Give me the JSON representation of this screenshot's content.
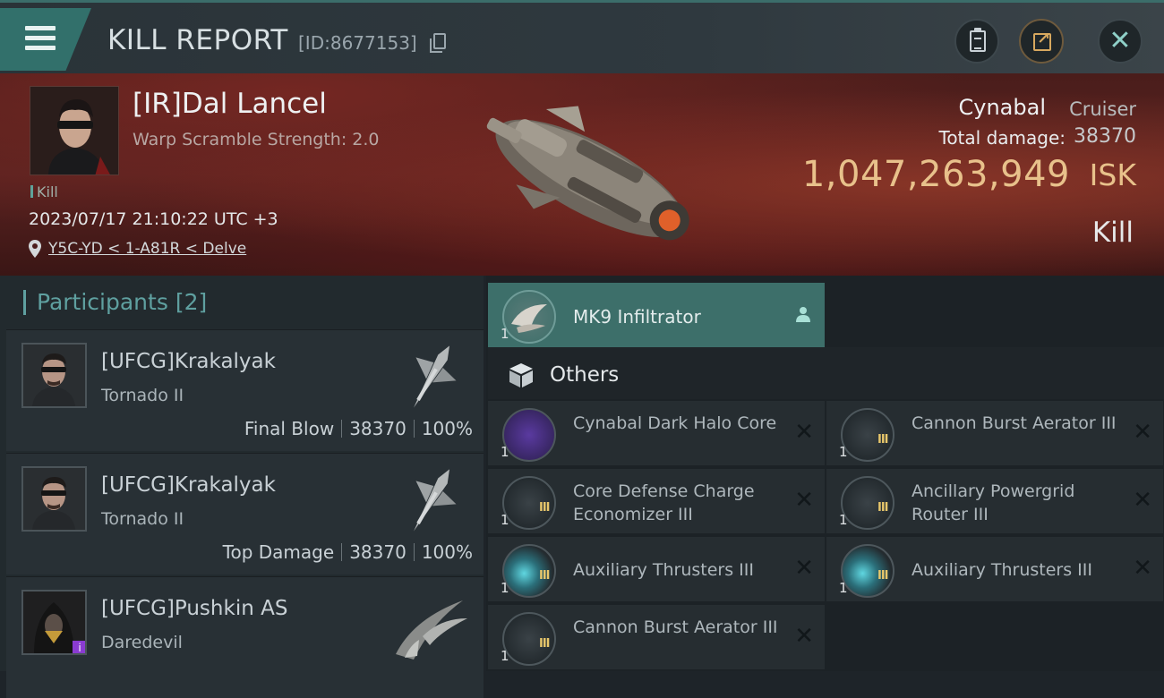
{
  "header": {
    "title": "KILL REPORT",
    "report_id": "[ID:8677153]",
    "menu_icon": "hamburger-menu-icon",
    "buttons": [
      "clipboard-icon",
      "share-icon",
      "close-icon"
    ]
  },
  "victim": {
    "name": "[IR]Dal Lancel",
    "warp_scramble": "Warp Scramble Strength: 2.0",
    "tag": "Kill",
    "time": "2023/07/17 21:10:22 UTC +3",
    "location": "Y5C-YD < 1-A81R < Delve",
    "ship_name": "Cynabal",
    "ship_class": "Cruiser",
    "total_damage_label": "Total damage:",
    "total_damage": "38370",
    "isk_value": "1,047,263,949",
    "isk_unit": "ISK",
    "result": "Kill"
  },
  "participants": {
    "header": "Participants",
    "count": "[2]",
    "rows": [
      {
        "name": "[UFCG]Krakalyak",
        "ship": "Tornado II",
        "role": "Final Blow",
        "damage": "38370",
        "percent": "100%"
      },
      {
        "name": "[UFCG]Krakalyak",
        "ship": "Tornado II",
        "role": "Top Damage",
        "damage": "38370",
        "percent": "100%"
      },
      {
        "name": "[UFCG]Pushkin AS",
        "ship": "Daredevil",
        "role": "",
        "damage": "",
        "percent": ""
      }
    ]
  },
  "pod": {
    "name": "MK9  Infiltrator",
    "qty": "1"
  },
  "others_label": "Others",
  "items": [
    {
      "name": "Cynabal Dark Halo Core",
      "qty": "1",
      "tier": ""
    },
    {
      "name": "Cannon Burst Aerator III",
      "qty": "1",
      "tier": "III"
    },
    {
      "name": "Core Defense Charge Economizer III",
      "qty": "1",
      "tier": "III"
    },
    {
      "name": "Ancillary Powergrid Router III",
      "qty": "1",
      "tier": "III"
    },
    {
      "name": "Auxiliary Thrusters III",
      "qty": "1",
      "tier": "III"
    },
    {
      "name": "Auxiliary Thrusters III",
      "qty": "1",
      "tier": "III"
    },
    {
      "name": "Cannon Burst Aerator III",
      "qty": "1",
      "tier": "III"
    }
  ],
  "colors": {
    "accent": "#3d6f6a",
    "isk": "#e8c18b",
    "banner": "#5a2220"
  }
}
